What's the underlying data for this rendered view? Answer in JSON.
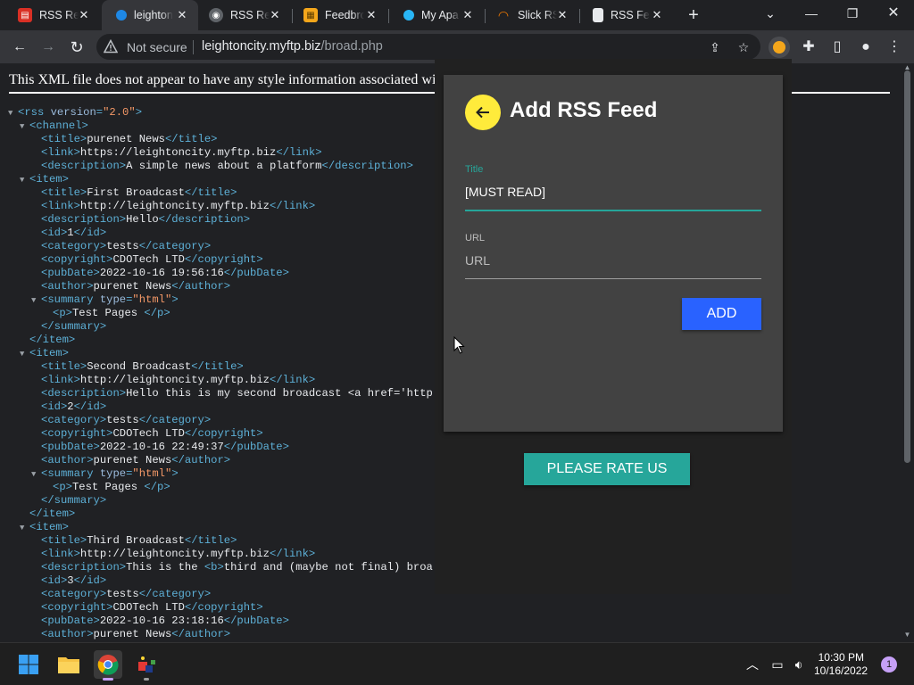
{
  "browser": {
    "tabs": [
      {
        "label": "RSS Rea",
        "icon": "rss-reader-icon"
      },
      {
        "label": "leighton",
        "icon": "site-icon",
        "active": true
      },
      {
        "label": "RSS Rea",
        "icon": "rss-reader-icon"
      },
      {
        "label": "Feedbro",
        "icon": "feedbro-icon"
      },
      {
        "label": "My Apa",
        "icon": "site-icon"
      },
      {
        "label": "Slick RS",
        "icon": "slick-rss-icon"
      },
      {
        "label": "RSS Fee",
        "icon": "document-icon"
      }
    ],
    "address": {
      "security": "Not secure",
      "host": "leightoncity.myftp.biz",
      "path": "/broad.php"
    }
  },
  "page": {
    "notice": "This XML file does not appear to have any style information associated wi",
    "xml_lines": [
      "<rss version=\"2.0\">",
      "<channel>",
      "<title>purenet News</title>",
      "<link>https://leightoncity.myftp.biz</link>",
      "<description>A simple news about a platform</description>",
      "<item>",
      "<title>First Broadcast</title>",
      "<link>http://leightoncity.myftp.biz</link>",
      "<description>Hello</description>",
      "<id>1</id>",
      "<category>tests</category>",
      "<copyright>CDOTech LTD</copyright>",
      "<pubDate>2022-10-16 19:56:16</pubDate>",
      "<author>purenet News</author>",
      "<summary type=\"html\">",
      "<p>Test Pages </p>",
      "</summary>",
      "</item>",
      "<item>",
      "<title>Second Broadcast</title>",
      "<link>http://leightoncity.myftp.biz</link>",
      "<description>Hello this is my second broadcast <a href='http",
      "<id>2</id>",
      "<category>tests</category>",
      "<copyright>CDOTech LTD</copyright>",
      "<pubDate>2022-10-16 22:49:37</pubDate>",
      "<author>purenet News</author>",
      "<summary type=\"html\">",
      "<p>Test Pages </p>",
      "</summary>",
      "</item>",
      "<item>",
      "<title>Third Broadcast</title>",
      "<link>http://leightoncity.myftp.biz</link>",
      "<description>This is the <b>third and (maybe not final) broa",
      "<id>3</id>",
      "<category>tests</category>",
      "<copyright>CDOTech LTD</copyright>",
      "<pubDate>2022-10-16 23:18:16</pubDate>",
      "<author>purenet News</author>"
    ],
    "xml_indent": [
      0,
      1,
      2,
      2,
      2,
      1,
      2,
      2,
      2,
      2,
      2,
      2,
      2,
      2,
      2,
      3,
      2,
      1,
      1,
      2,
      2,
      2,
      2,
      2,
      2,
      2,
      2,
      2,
      3,
      2,
      1,
      1,
      2,
      2,
      2,
      2,
      2,
      2,
      2,
      2
    ],
    "xml_toggle": [
      0,
      1,
      5,
      14,
      18,
      27,
      31
    ]
  },
  "popup": {
    "title": "Add RSS Feed",
    "title_field": {
      "label": "Title",
      "value": "[MUST READ]"
    },
    "url_field": {
      "label": "URL",
      "placeholder": "URL"
    },
    "add_label": "ADD",
    "rate_label": "PLEASE RATE US"
  },
  "taskbar": {
    "time": "10:30 PM",
    "date": "10/16/2022",
    "notifications": "1"
  },
  "colors": {
    "accent_teal": "#26a69a",
    "add_blue": "#2962ff",
    "back_yellow": "#ffeb3b",
    "card_bg": "#424242",
    "xml_tag": "#5db0d7"
  }
}
